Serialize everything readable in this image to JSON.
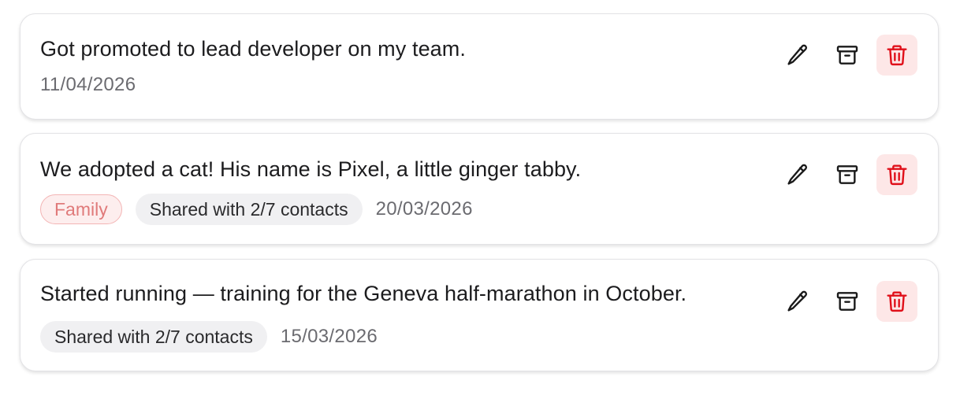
{
  "memories": [
    {
      "text": "Got promoted to lead developer on my team.",
      "date": "11/04/2026",
      "tags": []
    },
    {
      "text": "We adopted a cat! His name is Pixel, a little ginger tabby.",
      "date": "20/03/2026",
      "tags": [
        {
          "label": "Family"
        },
        {
          "label": "Shared with 2/7 contacts"
        }
      ]
    },
    {
      "text": "Started running — training for the Geneva half-marathon in October.",
      "date": "15/03/2026",
      "tags": [
        {
          "label": "Shared with 2/7 contacts"
        }
      ]
    }
  ],
  "actions": {
    "edit_icon": "pencil-icon",
    "archive_icon": "archive-icon",
    "delete_icon": "trash-icon"
  },
  "colors": {
    "delete_accent": "#e0101a",
    "delete_bg": "#fde7e7",
    "family_tag_text": "#e07a7a",
    "family_tag_bg": "#fdeeee",
    "shared_tag_bg": "#f0f0f2",
    "date_text": "#6b6b70"
  }
}
